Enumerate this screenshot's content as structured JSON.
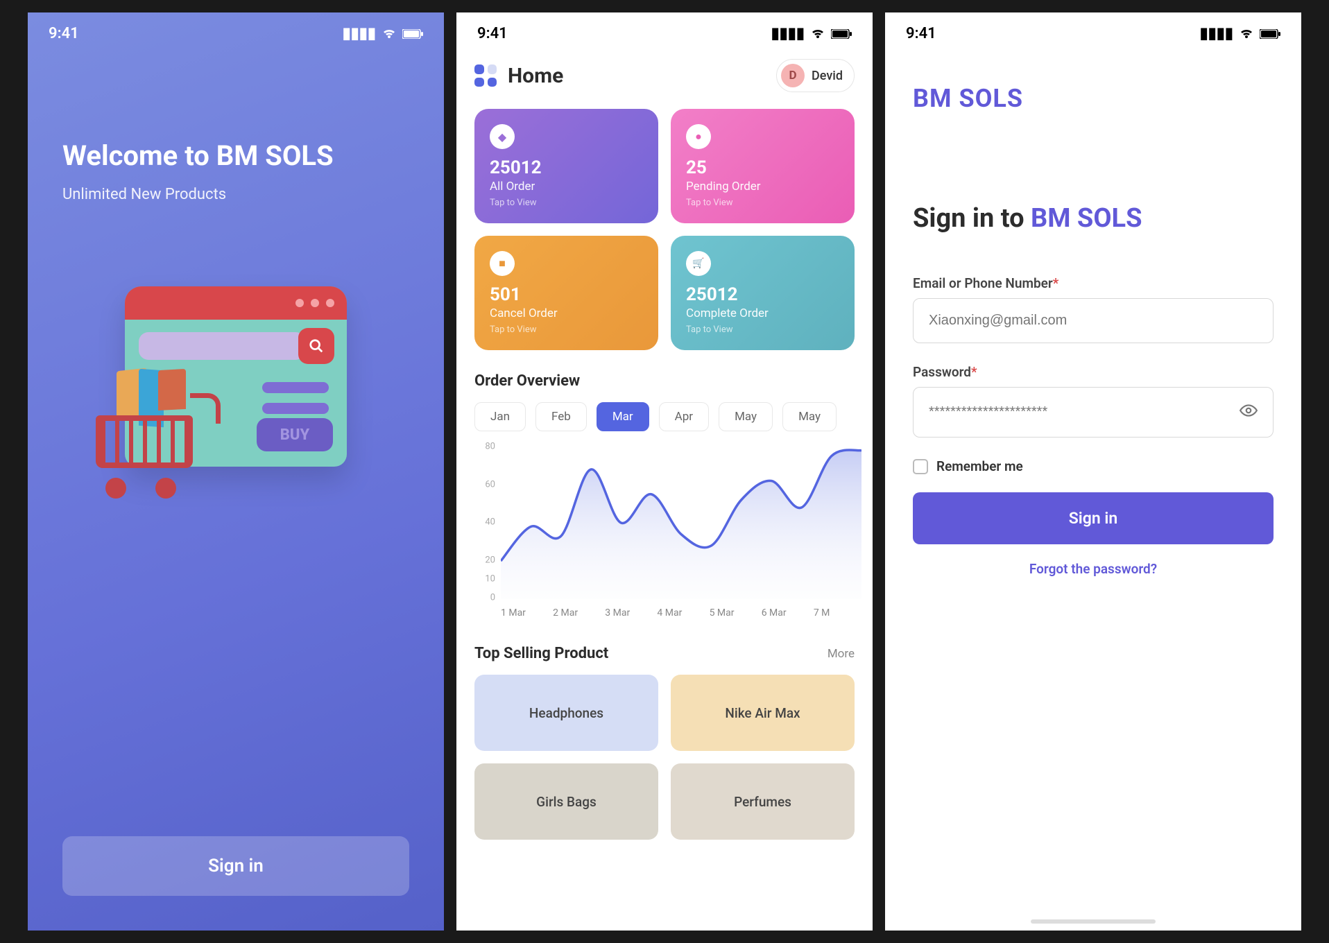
{
  "status_bar": {
    "time": "9:41"
  },
  "screen1": {
    "title": "Welcome to BM SOLS",
    "subtitle": "Unlimited New Products",
    "buy_label": "BUY",
    "signin_button": "Sign in"
  },
  "screen2": {
    "header_title": "Home",
    "user_initial": "D",
    "user_name": "Devid",
    "cards": [
      {
        "value": "25012",
        "label": "All Order",
        "tap": "Tap to View",
        "icon": "◆"
      },
      {
        "value": "25",
        "label": "Pending Order",
        "tap": "Tap to View",
        "icon": "●"
      },
      {
        "value": "501",
        "label": "Cancel Order",
        "tap": "Tap to View",
        "icon": "■"
      },
      {
        "value": "25012",
        "label": "Complete Order",
        "tap": "Tap to View",
        "icon": "🛒"
      }
    ],
    "overview_title": "Order Overview",
    "months": [
      "Jan",
      "Feb",
      "Mar",
      "Apr",
      "May",
      "May"
    ],
    "active_month_index": 2,
    "top_products_title": "Top Selling Product",
    "more_label": "More",
    "products": [
      "Headphones",
      "Nike Air Max",
      "Girls Bags",
      "Perfumes"
    ]
  },
  "screen3": {
    "brand": "BM SOLS",
    "title_prefix": "Sign in to ",
    "title_brand": "BM SOLS",
    "email_label": "Email or Phone Number",
    "email_placeholder": "Xiaonxing@gmail.com",
    "password_label": "Password",
    "password_placeholder": "**********************",
    "remember_label": "Remember me",
    "signin_button": "Sign in",
    "forgot_label": "Forgot the password?"
  },
  "chart_data": {
    "type": "line",
    "title": "Order Overview",
    "xlabel": "",
    "ylabel": "",
    "ylim": [
      0,
      80
    ],
    "y_ticks": [
      0,
      10,
      20,
      40,
      60,
      80
    ],
    "x_labels": [
      "1 Mar",
      "2 Mar",
      "3 Mar",
      "4 Mar",
      "5 Mar",
      "6 Mar",
      "7 M"
    ],
    "values": [
      20,
      38,
      33,
      68,
      40,
      55,
      34,
      28,
      52,
      62,
      48,
      75,
      78
    ]
  }
}
